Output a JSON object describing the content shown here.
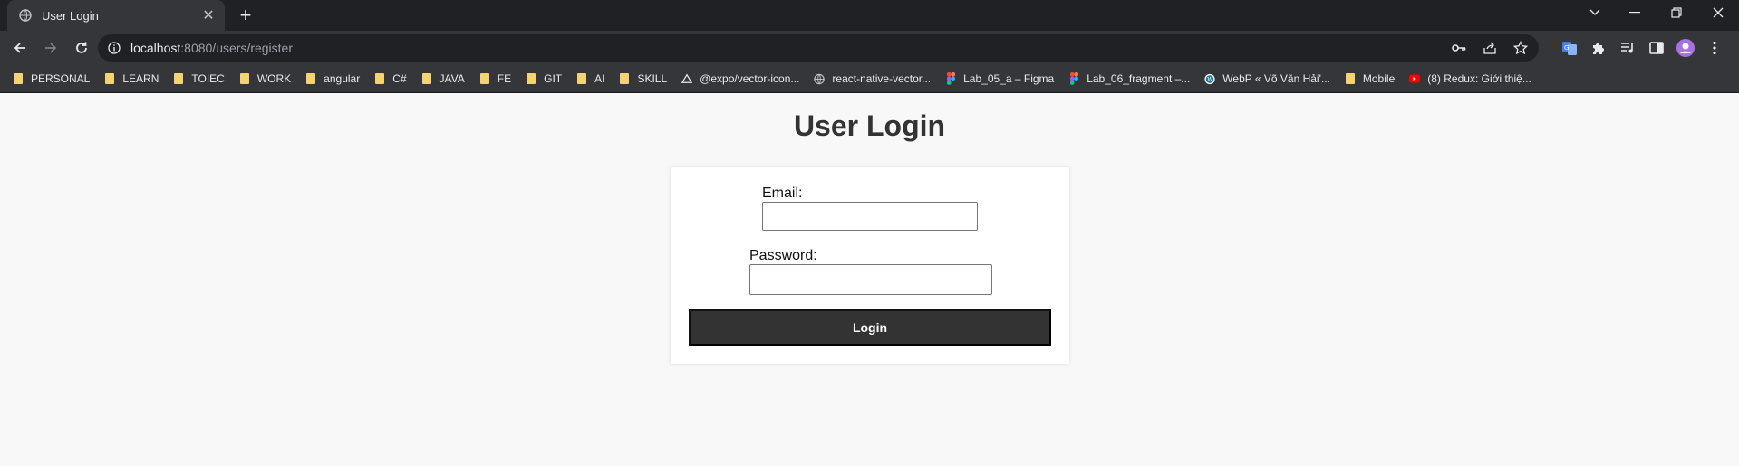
{
  "tab": {
    "title": "User Login"
  },
  "address": {
    "host": "localhost",
    "path": ":8080/users/register"
  },
  "bookmarks": [
    {
      "label": "PERSONAL",
      "icon": "folder-icon"
    },
    {
      "label": "LEARN",
      "icon": "folder-icon"
    },
    {
      "label": "TOIEC",
      "icon": "folder-icon"
    },
    {
      "label": "WORK",
      "icon": "folder-icon"
    },
    {
      "label": "angular",
      "icon": "folder-icon"
    },
    {
      "label": "C#",
      "icon": "folder-icon"
    },
    {
      "label": "JAVA",
      "icon": "folder-icon"
    },
    {
      "label": "FE",
      "icon": "folder-icon"
    },
    {
      "label": "GIT",
      "icon": "folder-icon"
    },
    {
      "label": "AI",
      "icon": "folder-icon"
    },
    {
      "label": "SKILL",
      "icon": "folder-icon"
    },
    {
      "label": "@expo/vector-icon...",
      "icon": "expo-icon"
    },
    {
      "label": "react-native-vector...",
      "icon": "globe-icon"
    },
    {
      "label": "Lab_05_a – Figma",
      "icon": "figma-icon"
    },
    {
      "label": "Lab_06_fragment –...",
      "icon": "figma-icon"
    },
    {
      "label": "WebP « Võ Văn Hải'...",
      "icon": "wordpress-icon"
    },
    {
      "label": "Mobile",
      "icon": "folder-icon"
    },
    {
      "label": "(8) Redux: Giới thiệ...",
      "icon": "youtube-icon"
    }
  ],
  "page": {
    "heading": "User Login",
    "email_label": "Email:",
    "email_value": "",
    "password_label": "Password:",
    "password_value": "",
    "login_button": "Login"
  },
  "colors": {
    "frame": "#202124",
    "toolbar": "#35363a",
    "page_bg": "#f8f8f8",
    "button_bg": "#333333",
    "folder": "#f6d372"
  }
}
